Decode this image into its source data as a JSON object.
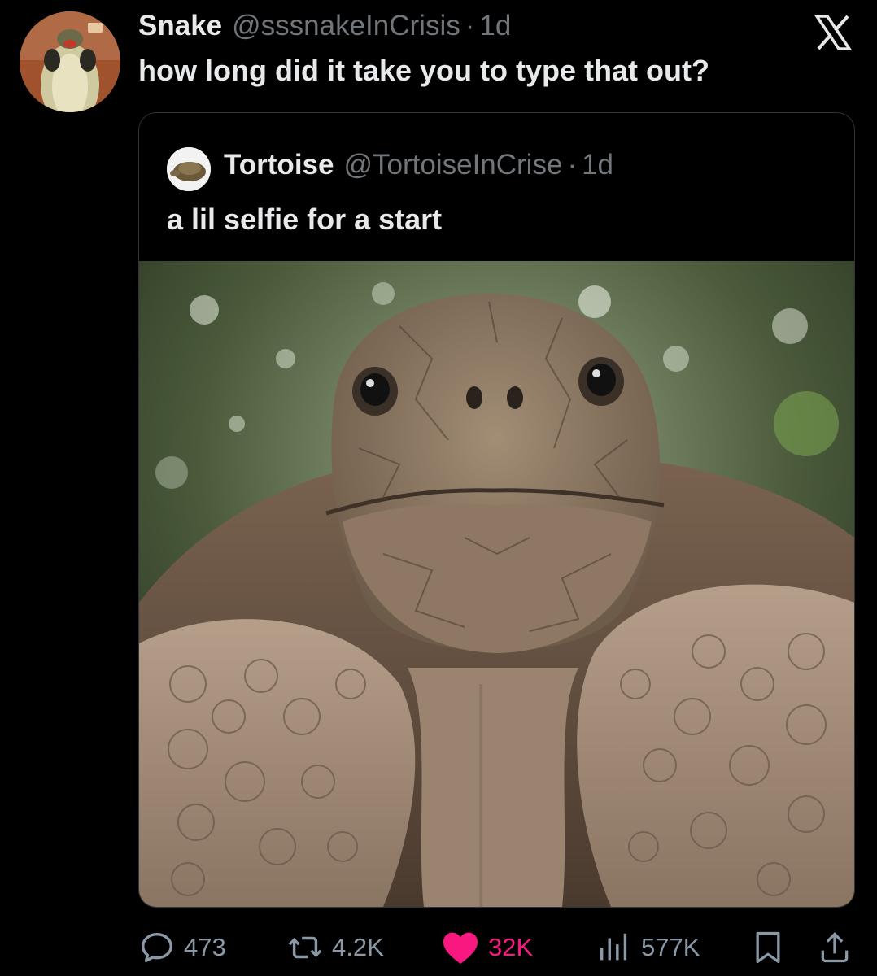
{
  "tweet": {
    "author": {
      "display_name": "Snake",
      "handle": "@sssnakeInCrisis",
      "time": "1d",
      "separator": "·"
    },
    "text": "how long did it take you to type that out?"
  },
  "quoted_tweet": {
    "author": {
      "display_name": "Tortoise",
      "handle": "@TortoiseInCrise",
      "time": "1d",
      "separator": "·"
    },
    "text": "a lil selfie for a start",
    "media": {
      "description_icon": "tortoise-photo"
    }
  },
  "actions": {
    "replies": "473",
    "reposts": "4.2K",
    "likes": "32K",
    "views": "577K"
  },
  "colors": {
    "background": "#000000",
    "text": "#e7e9ea",
    "muted": "#71767b",
    "like": "#f91880",
    "border": "#2f3336"
  },
  "icons": {
    "brand": "x-logo-icon",
    "reply": "reply-icon",
    "repost": "repost-icon",
    "like": "heart-icon",
    "views": "views-icon",
    "bookmark": "bookmark-icon",
    "share": "share-icon"
  }
}
